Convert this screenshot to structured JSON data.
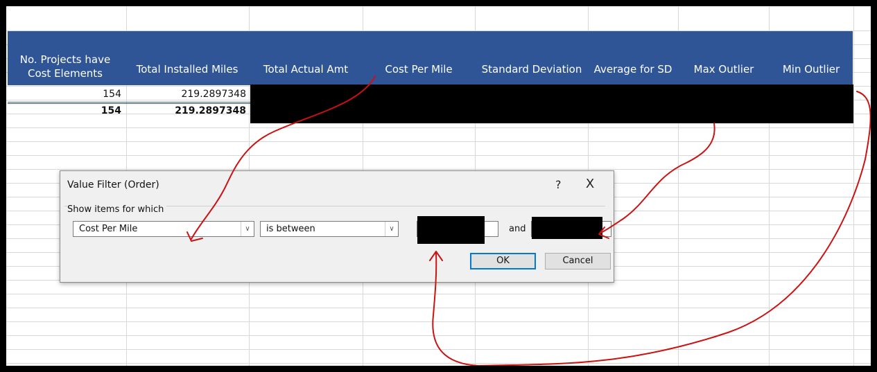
{
  "spreadsheet": {
    "headers": [
      "No. Projects have\nCost Elements",
      "Total Installed Miles",
      "Total Actual Amt",
      "Cost Per Mile",
      "Standard Deviation",
      "Average for SD",
      "Max Outlier",
      "Min Outlier"
    ],
    "rows": [
      {
        "projects": "154",
        "miles": "219.2897348"
      },
      {
        "projects": "154",
        "miles": "219.2897348"
      }
    ],
    "header_color": "#2f5597"
  },
  "dialog": {
    "title": "Value Filter (Order)",
    "help_glyph": "?",
    "close_glyph": "X",
    "section_label": "Show items for which",
    "field_select": "Cost Per Mile",
    "operator_select": "is between",
    "and_label": "and",
    "ok_label": "OK",
    "cancel_label": "Cancel",
    "dropdown_glyph": "∨"
  },
  "annotation_color": "#cc1111"
}
